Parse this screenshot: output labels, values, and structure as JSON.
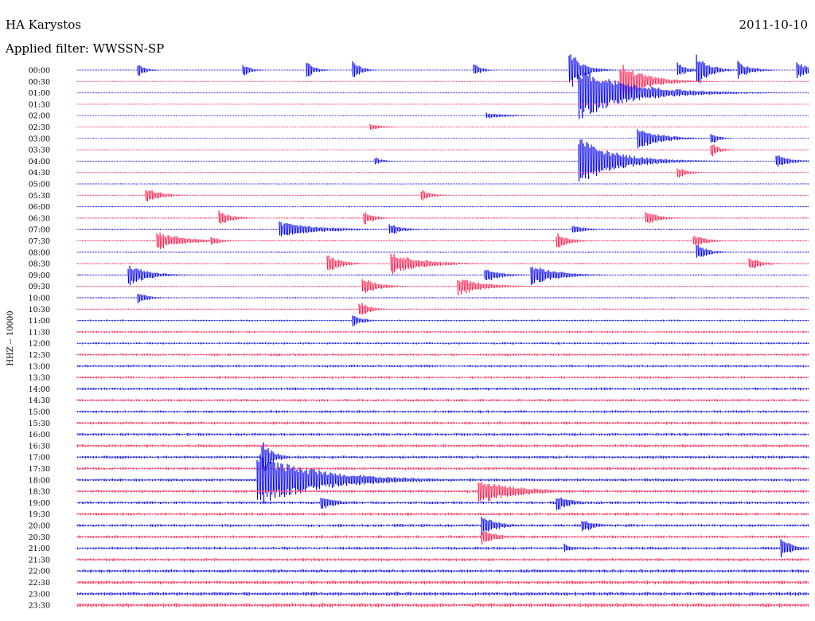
{
  "station": "HA Karystos",
  "date": "2011-10-10",
  "filter_label": "Applied filter: WWSSN-SP",
  "channel_label": "HHZ -- 10000",
  "colors": {
    "trace_even": "#0000ee",
    "trace_odd": "#ff1f4f",
    "text": "#000000",
    "background": "#ffffff"
  },
  "chart_data": {
    "type": "line",
    "title": "HA Karystos",
    "date": "2011-10-10",
    "subtitle": "Applied filter: WWSSN-SP",
    "ylabel": "HHZ -- 10000",
    "xlabel": "",
    "grid": false,
    "legend": "none",
    "row_labels": [
      "00:00",
      "00:30",
      "01:00",
      "01:30",
      "02:00",
      "02:30",
      "03:00",
      "03:30",
      "04:00",
      "04:30",
      "05:00",
      "05:30",
      "06:00",
      "06:30",
      "07:00",
      "07:30",
      "08:00",
      "08:30",
      "09:00",
      "09:30",
      "10:00",
      "10:30",
      "11:00",
      "11:30",
      "12:00",
      "12:30",
      "13:00",
      "13:30",
      "14:00",
      "14:30",
      "15:00",
      "15:30",
      "16:00",
      "16:30",
      "17:00",
      "17:30",
      "18:00",
      "18:30",
      "19:00",
      "19:30",
      "20:00",
      "20:30",
      "21:00",
      "21:30",
      "22:00",
      "22:30",
      "23:00",
      "23:30"
    ],
    "row_duration_minutes": 30,
    "row_noise_level": [
      0.35,
      0.35,
      0.35,
      0.35,
      0.35,
      0.35,
      0.35,
      0.35,
      0.4,
      0.4,
      0.4,
      0.45,
      0.5,
      0.55,
      0.55,
      0.55,
      0.55,
      0.55,
      0.55,
      0.55,
      0.55,
      0.55,
      0.8,
      1.0,
      1.0,
      1.2,
      1.2,
      1.2,
      1.3,
      1.3,
      1.3,
      1.4,
      1.4,
      1.4,
      1.4,
      1.4,
      1.4,
      1.4,
      1.4,
      1.4,
      1.4,
      1.4,
      1.4,
      1.4,
      1.6,
      1.8,
      1.8,
      1.9
    ],
    "events": [
      {
        "row": 0,
        "minute": 20.2,
        "amplitude": 26,
        "duration_min": 0.5
      },
      {
        "row": 0,
        "minute": 25.4,
        "amplitude": 22,
        "duration_min": 0.5
      },
      {
        "row": 0,
        "minute": 27.1,
        "amplitude": 12,
        "duration_min": 0.5
      },
      {
        "row": 0,
        "minute": 24.6,
        "amplitude": 10,
        "duration_min": 0.4
      },
      {
        "row": 0,
        "minute": 29.5,
        "amplitude": 12,
        "duration_min": 0.5
      },
      {
        "row": 0,
        "minute": 2.5,
        "amplitude": 8,
        "duration_min": 0.3
      },
      {
        "row": 0,
        "minute": 6.8,
        "amplitude": 8,
        "duration_min": 0.3
      },
      {
        "row": 0,
        "minute": 16.3,
        "amplitude": 8,
        "duration_min": 0.3
      },
      {
        "row": 0,
        "minute": 9.4,
        "amplitude": 12,
        "duration_min": 0.3
      },
      {
        "row": 0,
        "minute": 11.3,
        "amplitude": 14,
        "duration_min": 0.3
      },
      {
        "row": 1,
        "minute": 22.3,
        "amplitude": 24,
        "duration_min": 1.0
      },
      {
        "row": 2,
        "minute": 20.6,
        "amplitude": 34,
        "duration_min": 2.0
      },
      {
        "row": 4,
        "minute": 16.8,
        "amplitude": 4,
        "duration_min": 0.8
      },
      {
        "row": 5,
        "minute": 12.0,
        "amplitude": 4,
        "duration_min": 0.5
      },
      {
        "row": 6,
        "minute": 23.0,
        "amplitude": 14,
        "duration_min": 0.9
      },
      {
        "row": 6,
        "minute": 26.0,
        "amplitude": 8,
        "duration_min": 0.3
      },
      {
        "row": 7,
        "minute": 26.0,
        "amplitude": 10,
        "duration_min": 0.3
      },
      {
        "row": 8,
        "minute": 20.6,
        "amplitude": 30,
        "duration_min": 1.5
      },
      {
        "row": 8,
        "minute": 28.7,
        "amplitude": 8,
        "duration_min": 0.6
      },
      {
        "row": 8,
        "minute": 12.2,
        "amplitude": 6,
        "duration_min": 0.3
      },
      {
        "row": 9,
        "minute": 24.6,
        "amplitude": 8,
        "duration_min": 0.4
      },
      {
        "row": 11,
        "minute": 2.8,
        "amplitude": 10,
        "duration_min": 0.6
      },
      {
        "row": 11,
        "minute": 14.1,
        "amplitude": 8,
        "duration_min": 0.4
      },
      {
        "row": 13,
        "minute": 5.8,
        "amplitude": 10,
        "duration_min": 0.5
      },
      {
        "row": 13,
        "minute": 11.8,
        "amplitude": 8,
        "duration_min": 0.4
      },
      {
        "row": 13,
        "minute": 23.3,
        "amplitude": 10,
        "duration_min": 0.5
      },
      {
        "row": 14,
        "minute": 8.3,
        "amplitude": 10,
        "duration_min": 1.5
      },
      {
        "row": 14,
        "minute": 12.8,
        "amplitude": 8,
        "duration_min": 0.5
      },
      {
        "row": 14,
        "minute": 20.3,
        "amplitude": 6,
        "duration_min": 0.5
      },
      {
        "row": 15,
        "minute": 3.3,
        "amplitude": 12,
        "duration_min": 1.0
      },
      {
        "row": 15,
        "minute": 5.5,
        "amplitude": 6,
        "duration_min": 0.4
      },
      {
        "row": 15,
        "minute": 19.7,
        "amplitude": 10,
        "duration_min": 0.5
      },
      {
        "row": 15,
        "minute": 25.3,
        "amplitude": 8,
        "duration_min": 0.5
      },
      {
        "row": 16,
        "minute": 25.4,
        "amplitude": 10,
        "duration_min": 0.5
      },
      {
        "row": 17,
        "minute": 12.9,
        "amplitude": 14,
        "duration_min": 1.2
      },
      {
        "row": 17,
        "minute": 10.3,
        "amplitude": 12,
        "duration_min": 0.5
      },
      {
        "row": 17,
        "minute": 27.6,
        "amplitude": 8,
        "duration_min": 0.5
      },
      {
        "row": 18,
        "minute": 2.1,
        "amplitude": 14,
        "duration_min": 0.8
      },
      {
        "row": 18,
        "minute": 18.6,
        "amplitude": 14,
        "duration_min": 1.0
      },
      {
        "row": 18,
        "minute": 16.7,
        "amplitude": 10,
        "duration_min": 0.6
      },
      {
        "row": 19,
        "minute": 11.7,
        "amplitude": 12,
        "duration_min": 0.6
      },
      {
        "row": 19,
        "minute": 15.6,
        "amplitude": 12,
        "duration_min": 1.0
      },
      {
        "row": 20,
        "minute": 2.5,
        "amplitude": 8,
        "duration_min": 0.4
      },
      {
        "row": 21,
        "minute": 11.6,
        "amplitude": 10,
        "duration_min": 0.4
      },
      {
        "row": 22,
        "minute": 11.3,
        "amplitude": 8,
        "duration_min": 0.4
      },
      {
        "row": 34,
        "minute": 7.6,
        "amplitude": 22,
        "duration_min": 0.4
      },
      {
        "row": 36,
        "minute": 7.4,
        "amplitude": 34,
        "duration_min": 2.5
      },
      {
        "row": 37,
        "minute": 16.5,
        "amplitude": 16,
        "duration_min": 1.5
      },
      {
        "row": 38,
        "minute": 10.0,
        "amplitude": 10,
        "duration_min": 0.6
      },
      {
        "row": 38,
        "minute": 19.7,
        "amplitude": 10,
        "duration_min": 0.6
      },
      {
        "row": 40,
        "minute": 20.7,
        "amplitude": 10,
        "duration_min": 0.5
      },
      {
        "row": 40,
        "minute": 16.6,
        "amplitude": 14,
        "duration_min": 0.6
      },
      {
        "row": 41,
        "minute": 16.6,
        "amplitude": 10,
        "duration_min": 0.6
      },
      {
        "row": 42,
        "minute": 28.9,
        "amplitude": 12,
        "duration_min": 0.5
      },
      {
        "row": 42,
        "minute": 20.0,
        "amplitude": 6,
        "duration_min": 0.4
      }
    ]
  }
}
